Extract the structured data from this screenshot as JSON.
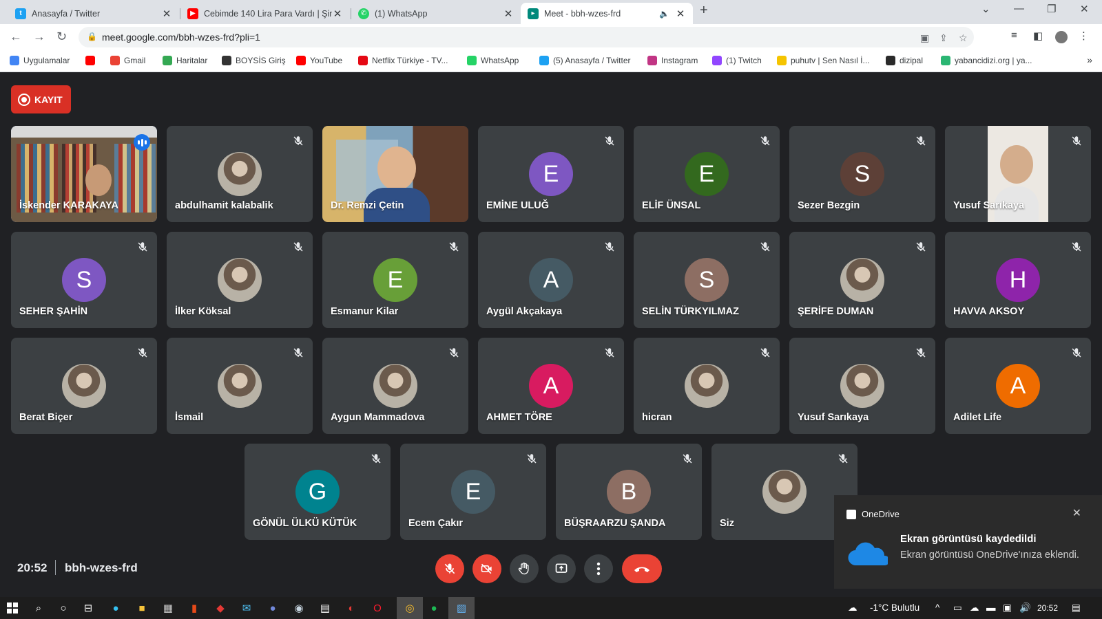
{
  "browser": {
    "tabs": [
      {
        "title": "Anasayfa / Twitter",
        "icon": "twitter-icon",
        "color": "#1da1f2"
      },
      {
        "title": "Cebimde 140 Lira Para Vardı | Şim",
        "icon": "youtube-icon",
        "color": "#ff0000"
      },
      {
        "title": "(1) WhatsApp",
        "icon": "whatsapp-icon",
        "color": "#25d366"
      },
      {
        "title": "Meet - bbh-wzes-frd",
        "icon": "meet-icon",
        "color": "#00897b"
      }
    ],
    "url": "meet.google.com/bbh-wzes-frd?pli=1",
    "bookmarks": [
      {
        "label": "Uygulamalar",
        "color": "#4285f4"
      },
      {
        "label": "",
        "color": "#ff0000"
      },
      {
        "label": "Gmail",
        "color": "#ea4335"
      },
      {
        "label": "Haritalar",
        "color": "#34a853"
      },
      {
        "label": "BOYSİS Giriş",
        "color": "#333333"
      },
      {
        "label": "YouTube",
        "color": "#ff0000"
      },
      {
        "label": "Netflix Türkiye - TV...",
        "color": "#e50914"
      },
      {
        "label": "WhatsApp",
        "color": "#25d366"
      },
      {
        "label": "(5) Anasayfa / Twitter",
        "color": "#1da1f2"
      },
      {
        "label": "Instagram",
        "color": "#c13584"
      },
      {
        "label": "(1) Twitch",
        "color": "#9146ff"
      },
      {
        "label": "puhutv | Sen Nasıl İ...",
        "color": "#f5c400"
      },
      {
        "label": "dizipal",
        "color": "#2a2a2a"
      },
      {
        "label": "yabancidizi.org | ya...",
        "color": "#2bb673"
      }
    ],
    "bookmarks_more": "»"
  },
  "meet": {
    "record_label": "KAYIT",
    "participants": [
      {
        "name": "İskender KARAKAYA",
        "kind": "video",
        "speaking": true
      },
      {
        "name": "abdulhamit kalabalik",
        "kind": "photo"
      },
      {
        "name": "Dr. Remzi Çetin",
        "kind": "video2"
      },
      {
        "name": "EMİNE ULUĞ",
        "kind": "letter",
        "letter": "E",
        "color": "#7e57c2"
      },
      {
        "name": "ELİF ÜNSAL",
        "kind": "letter",
        "letter": "E",
        "color": "#33691e"
      },
      {
        "name": "Sezer Bezgin",
        "kind": "letter",
        "letter": "S",
        "color": "#5d4037"
      },
      {
        "name": "Yusuf Sarıkaya",
        "kind": "video3"
      },
      {
        "name": "SEHER ŞAHİN",
        "kind": "letter",
        "letter": "S",
        "color": "#7e57c2"
      },
      {
        "name": "İlker Köksal",
        "kind": "photo"
      },
      {
        "name": "Esmanur Kilar",
        "kind": "letter",
        "letter": "E",
        "color": "#689f38"
      },
      {
        "name": "Aygül Akçakaya",
        "kind": "letter",
        "letter": "A",
        "color": "#455a64"
      },
      {
        "name": "SELİN TÜRKYILMAZ",
        "kind": "letter",
        "letter": "S",
        "color": "#8d6e63"
      },
      {
        "name": "ŞERİFE DUMAN",
        "kind": "photo"
      },
      {
        "name": "HAVVA AKSOY",
        "kind": "letter",
        "letter": "H",
        "color": "#8e24aa"
      },
      {
        "name": "Berat Biçer",
        "kind": "photo"
      },
      {
        "name": "İsmail",
        "kind": "photo"
      },
      {
        "name": "Aygun Mammadova",
        "kind": "photo"
      },
      {
        "name": "AHMET TÖRE",
        "kind": "letter",
        "letter": "A",
        "color": "#d81b60"
      },
      {
        "name": "hicran",
        "kind": "photo"
      },
      {
        "name": "Yusuf Sarıkaya",
        "kind": "photo"
      },
      {
        "name": "Adilet Life",
        "kind": "letter",
        "letter": "A",
        "color": "#ef6c00"
      },
      {
        "name": "GÖNÜL ÜLKÜ KÜTÜK",
        "kind": "letter",
        "letter": "G",
        "color": "#00838f"
      },
      {
        "name": "Ecem Çakır",
        "kind": "letter",
        "letter": "E",
        "color": "#455a64"
      },
      {
        "name": "BÜŞRAARZU ŞANDA",
        "kind": "letter",
        "letter": "B",
        "color": "#8d6e63"
      },
      {
        "name": "Siz",
        "kind": "photo"
      }
    ],
    "time": "20:52",
    "meeting_code": "bbh-wzes-frd"
  },
  "toast": {
    "app": "OneDrive",
    "title": "Ekran görüntüsü kaydedildi",
    "body": "Ekran görüntüsü OneDrive'ınıza eklendi."
  },
  "taskbar": {
    "weather": "-1°C  Bulutlu",
    "time": "20:52"
  }
}
